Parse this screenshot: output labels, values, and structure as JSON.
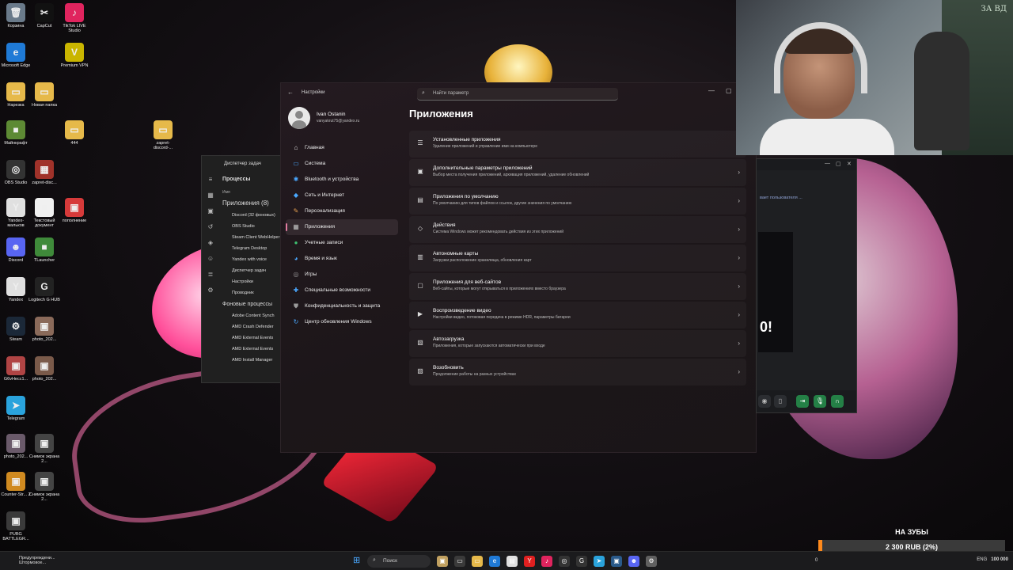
{
  "desktop": {
    "icons": [
      {
        "label": "Корзина",
        "glyph": "🗑",
        "color": "#6a7a8a"
      },
      {
        "label": "CapCut",
        "glyph": "✂",
        "color": "#111111"
      },
      {
        "label": "TikTok LIVE Studio",
        "glyph": "♪",
        "color": "#e0245e"
      },
      {
        "label": "Microsoft Edge",
        "glyph": "e",
        "color": "#1f7ad6"
      },
      {
        "label": "Premium VPN",
        "glyph": "V",
        "color": "#c9b500"
      },
      {
        "label": "Нарезка",
        "glyph": "▭",
        "color": "#e6b94a"
      },
      {
        "label": "Новая папка",
        "glyph": "▭",
        "color": "#e6b94a"
      },
      {
        "label": "Майнкрафт",
        "glyph": "■",
        "color": "#5d8a34"
      },
      {
        "label": "444",
        "glyph": "▭",
        "color": "#e6b94a"
      },
      {
        "label": "zapret-discord-...",
        "glyph": "▭",
        "color": "#e6b94a"
      },
      {
        "label": "OBS Studio",
        "glyph": "◎",
        "color": "#333333"
      },
      {
        "label": "zapret-disc...",
        "glyph": "▦",
        "color": "#a0322a"
      },
      {
        "label": "Yandex-мальков",
        "glyph": "Y",
        "color": "#e0e0e0"
      },
      {
        "label": "Текстовый документ",
        "glyph": "≡",
        "color": "#f0f0f0"
      },
      {
        "label": "пополнение",
        "glyph": "▣",
        "color": "#d63a3a"
      },
      {
        "label": "Discord",
        "glyph": "☻",
        "color": "#5865f2"
      },
      {
        "label": "TLauncher",
        "glyph": "■",
        "color": "#3f8a3a"
      },
      {
        "label": "Yandex",
        "glyph": "Y",
        "color": "#e0e0e0"
      },
      {
        "label": "Logitech G HUB",
        "glyph": "G",
        "color": "#222222"
      },
      {
        "label": "Steam",
        "glyph": "⚙",
        "color": "#1b2838"
      },
      {
        "label": "photo_202...",
        "glyph": "▣",
        "color": "#8a6a5a"
      },
      {
        "label": "G6vHecc1...",
        "glyph": "▣",
        "color": "#b04444"
      },
      {
        "label": "photo_202...",
        "glyph": "▣",
        "color": "#7a5a4a"
      },
      {
        "label": "Telegram",
        "glyph": "➤",
        "color": "#2aa3dc"
      },
      {
        "label": "photo_202...",
        "glyph": "▣",
        "color": "#6a5a6a"
      },
      {
        "label": "Снимок экрана 2...",
        "glyph": "▣",
        "color": "#444444"
      },
      {
        "label": "Counter-Str... 2",
        "glyph": "▣",
        "color": "#d08a20"
      },
      {
        "label": "Снимок экрана 2...",
        "glyph": "▣",
        "color": "#444444"
      },
      {
        "label": "PUBG BATTLEGR...",
        "glyph": "▣",
        "color": "#3a3a3a"
      }
    ]
  },
  "taskmgr": {
    "title": "Диспетчер задач",
    "section_title": "Процессы",
    "col_name": "Имя",
    "apps_group": "Приложения (8)",
    "apps": [
      "Discord (32 фоновых)",
      "OBS Studio",
      "Steam Client WebHelper",
      "Telegram Desktop",
      "Yandex with voice",
      "Диспетчер задач",
      "Настройки",
      "Проводник"
    ],
    "bg_group": "Фоновые процессы",
    "bg": [
      "Adobe Content Synch",
      "AMD Crash Defender",
      "AMD External Events",
      "AMD External Events",
      "AMD Install Manager"
    ]
  },
  "settings": {
    "app_title": "Настройки",
    "search_placeholder": "Найти параметр",
    "user": {
      "name": "Ivan Ostanin",
      "email": "vanyakrut75@yandex.ru"
    },
    "nav": [
      {
        "label": "Главная",
        "icon": "⌂",
        "color": "#e5e5e5",
        "active": false
      },
      {
        "label": "Система",
        "icon": "▭",
        "color": "#4aa8ff",
        "active": false
      },
      {
        "label": "Bluetooth и устройства",
        "icon": "✱",
        "color": "#4aa8ff",
        "active": false
      },
      {
        "label": "Сеть и Интернет",
        "icon": "◆",
        "color": "#4aa8ff",
        "active": false
      },
      {
        "label": "Персонализация",
        "icon": "✎",
        "color": "#e6a050",
        "active": false
      },
      {
        "label": "Приложения",
        "icon": "▦",
        "color": "#c0c0c0",
        "active": true
      },
      {
        "label": "Учетные записи",
        "icon": "●",
        "color": "#3ec070",
        "active": false
      },
      {
        "label": "Время и язык",
        "icon": "◕",
        "color": "#4aa8ff",
        "active": false
      },
      {
        "label": "Игры",
        "icon": "◎",
        "color": "#9a9a9a",
        "active": false
      },
      {
        "label": "Специальные возможности",
        "icon": "✚",
        "color": "#4aa8ff",
        "active": false
      },
      {
        "label": "Конфиденциальность и защита",
        "icon": "⛊",
        "color": "#9a9a9a",
        "active": false
      },
      {
        "label": "Центр обновления Windows",
        "icon": "↻",
        "color": "#4aa8ff",
        "active": false
      }
    ],
    "page_title": "Приложения",
    "items": [
      {
        "title": "Установленные приложения",
        "desc": "Удаление приложений и управление ими на компьютере",
        "icon": "☰",
        "chevron": ""
      },
      {
        "title": "Дополнительные параметры приложений",
        "desc": "Выбор места получения приложений, архивация приложений, удаление обновлений",
        "icon": "▣",
        "chevron": "›"
      },
      {
        "title": "Приложения по умолчанию",
        "desc": "По умолчанию для типов файлов и ссылок, другие значения по умолчанию",
        "icon": "▤",
        "chevron": "›"
      },
      {
        "title": "Действия",
        "desc": "Система Windows может рекомендовать действия из этих приложений",
        "icon": "◇",
        "chevron": "›"
      },
      {
        "title": "Автономные карты",
        "desc": "Загрузки расположение хранилища, обновления карт",
        "icon": "▥",
        "chevron": "›"
      },
      {
        "title": "Приложения для веб-сайтов",
        "desc": "Веб-сайты, которые могут открываться в приложениях вместо браузера",
        "icon": "▢",
        "chevron": "›"
      },
      {
        "title": "Воспроизведение видео",
        "desc": "Настройки видео, потоковая передача в режиме HDR, параметры батареи",
        "icon": "▶",
        "chevron": "›"
      },
      {
        "title": "Автозагрузка",
        "desc": "Приложения, которые запускаются автоматически при входе",
        "icon": "▧",
        "chevron": "›"
      },
      {
        "title": "Возобновить",
        "desc": "Продолжение работы на разных устройствах",
        "icon": "▨",
        "chevron": "›"
      }
    ]
  },
  "webcam": {
    "wall_text": "ЗА ВД"
  },
  "discord": {
    "hint": "вает пользователя ...",
    "stream_text": "0!"
  },
  "donation": {
    "title": "НА ЗУБЫ",
    "amount": "2 300 RUB (2%)",
    "progress": 0.02,
    "left_value": "0",
    "right_value": "100 000"
  },
  "taskbar": {
    "weather": [
      "Предупреждени...",
      "Штормовое..."
    ],
    "search_label": "Поиск",
    "apps": [
      {
        "glyph": "▣",
        "color": "#c0a060"
      },
      {
        "glyph": "▭",
        "color": "#3a3a3a"
      },
      {
        "glyph": "▭",
        "color": "#e6b94a"
      },
      {
        "glyph": "e",
        "color": "#1f7ad6"
      },
      {
        "glyph": "▤",
        "color": "#e0e0e0"
      },
      {
        "glyph": "Y",
        "color": "#e02020"
      },
      {
        "glyph": "♪",
        "color": "#e0245e"
      },
      {
        "glyph": "◎",
        "color": "#333333"
      },
      {
        "glyph": "G",
        "color": "#333333"
      },
      {
        "glyph": "➤",
        "color": "#2aa3dc"
      },
      {
        "glyph": "▣",
        "color": "#2a5a8a"
      },
      {
        "glyph": "☻",
        "color": "#5865f2"
      },
      {
        "glyph": "⚙",
        "color": "#606060"
      }
    ],
    "tray": "ENG"
  }
}
